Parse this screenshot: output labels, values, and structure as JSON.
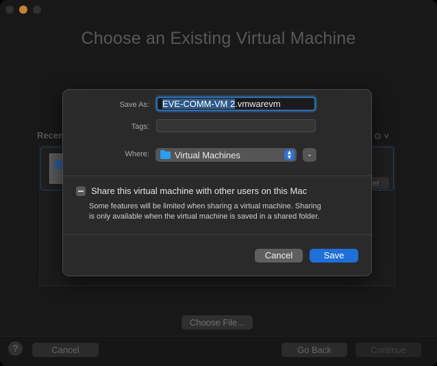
{
  "window": {
    "background_title": "Choose an Existing Virtual Machine",
    "recents_label": "Recen",
    "folder_button_peek": "lder",
    "more_icon": "ellipsis-circle-icon",
    "choose_file_label": "Choose File...",
    "help_label": "?",
    "cancel_label": "Cancel",
    "go_back_label": "Go Back",
    "continue_label": "Continue"
  },
  "sheet": {
    "save_as_label": "Save As:",
    "save_as_selected": "EVE-COMM-VM 2",
    "save_as_suffix": ".vmwarevm",
    "tags_label": "Tags:",
    "where_label": "Where:",
    "where_value": "Virtual Machines",
    "share_label": "Share this virtual machine with other users on this Mac",
    "share_description": "Some features will be limited when sharing a virtual machine. Sharing is only available when the virtual machine is saved in a shared folder.",
    "cancel_label": "Cancel",
    "save_label": "Save"
  },
  "colors": {
    "accent": "#1f6fd8",
    "focus_ring": "#2d6fb0",
    "traffic_yellow": "#f0a23a",
    "folder_icon": "#2a9df4"
  }
}
